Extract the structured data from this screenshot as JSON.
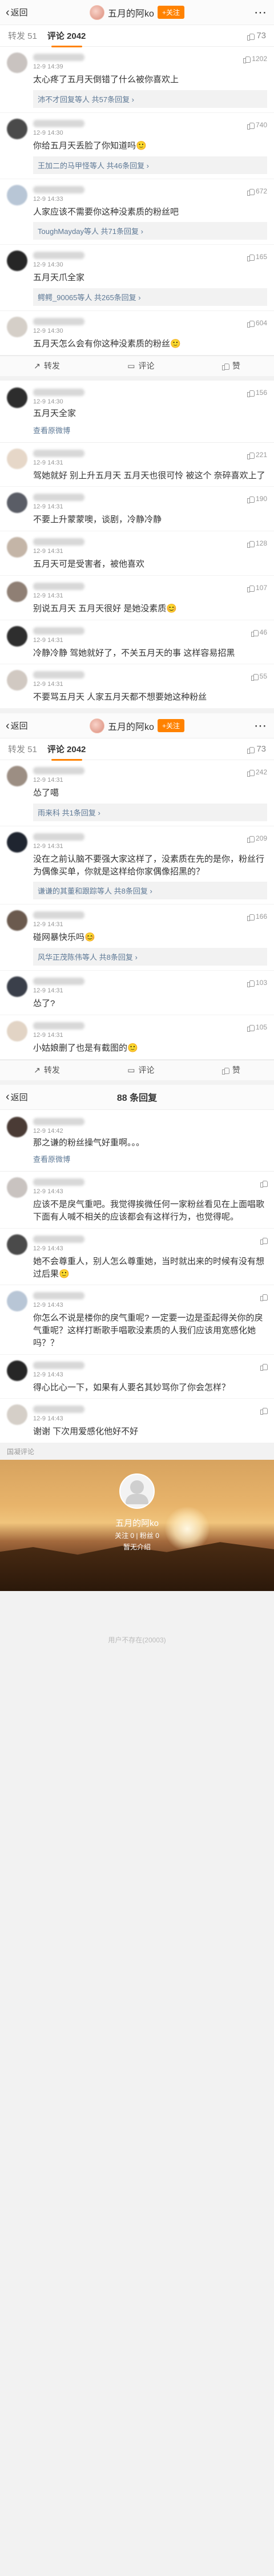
{
  "screen1": {
    "back_label": "返回",
    "title": "五月的阿ko",
    "follow_label": "+关注",
    "tabs": {
      "repost": "转发 51",
      "comment": "评论 2042",
      "likes": "73"
    },
    "comments": [
      {
        "time": "12-9 14:39",
        "text": "太心疼了五月天倒错了什么被你喜欢上",
        "replies": "沛不才回复等人 共57条回复 ›",
        "likes": "1202"
      },
      {
        "time": "12-9 14:30",
        "text": "你给五月天丢脸了你知道吗🙂",
        "replies": "王加二的马甲怪等人 共46条回复 ›",
        "likes": "740"
      },
      {
        "time": "12-9 14:33",
        "text": "人家应该不需要你这种没素质的粉丝吧",
        "replies": "ToughMayday等人 共71条回复 ›",
        "likes": "672"
      },
      {
        "time": "12-9 14:30",
        "text": "五月天爪全家",
        "replies": "鳄鳄_90065等人 共265条回复 ›",
        "likes": "165"
      },
      {
        "time": "12-9 14:30",
        "text": "五月天怎么会有你这种没素质的粉丝🙂",
        "replies": "",
        "likes": "604"
      }
    ],
    "bottom": {
      "repost": "转发",
      "comment": "评论",
      "like": "赞"
    }
  },
  "screen2": {
    "head_likes": "156",
    "head_time": "12-9 14:30",
    "head_text": "五月天全家",
    "view_original": "查看原微博",
    "comments": [
      {
        "time": "12-9 14:31",
        "text": "驾她就好 别上升五月天 五月天也很可怜 被这个 奈碎喜欢上了",
        "likes": "221"
      },
      {
        "time": "12-9 14:31",
        "text": "不要上升蒙蒙噢，谈剧，冷静冷静",
        "likes": "190"
      },
      {
        "time": "12-9 14:31",
        "text": "五月天可是受害者，被他喜欢",
        "likes": "128"
      },
      {
        "time": "12-9 14:31",
        "text": "别说五月天 五月天很好 是她没素质😊",
        "likes": "107"
      },
      {
        "time": "12-9 14:31",
        "text": "冷静冷静 驾她就好了，不关五月天的事 这样容易招黑",
        "likes": "46"
      },
      {
        "time": "12-9 14:31",
        "text": "不要骂五月天 人家五月天都不想要她这种粉丝",
        "likes": "55"
      }
    ]
  },
  "screen3": {
    "back_label": "返回",
    "title": "五月的阿ko",
    "follow_label": "+关注",
    "tabs": {
      "repost": "转发 51",
      "comment": "评论 2042",
      "likes": "73"
    },
    "comments": [
      {
        "time": "12-9 14:31",
        "text": "怂了噶",
        "replies": "雨来科 共1条回复 ›",
        "likes": "242"
      },
      {
        "time": "12-9 14:31",
        "text": "没在之前认脑不要强大家这样了，没素质在先的是你，粉丝行为偶像买单，你就是这样给你家偶像招黑的？",
        "replies": "谦谦的其董和跟踪等人 共8条回复 ›",
        "likes": "209"
      },
      {
        "time": "12-9 14:31",
        "text": "碰网暴快乐吗😊",
        "replies": "风华正茂陈伟等人 共8条回复 ›",
        "likes": "166"
      },
      {
        "time": "12-9 14:31",
        "text": "怂了?",
        "replies": "",
        "likes": "103"
      },
      {
        "time": "12-9 14:31",
        "text": "小姑娘删了也是有截图的🙂",
        "replies": "",
        "likes": "105"
      }
    ],
    "bottom": {
      "repost": "转发",
      "comment": "评论",
      "like": "赞"
    }
  },
  "screen4": {
    "back_label": "返回",
    "title": "88 条回复",
    "head_time": "12-9 14:42",
    "head_text": "那之谦的粉丝操气好重啊。。。",
    "view_original": "查看原微博",
    "comments": [
      {
        "time": "12-9 14:43",
        "text": "应该不是戾气重吧。我觉得挨微任何一家粉丝看见在上面唱歌下面有人喊不相关的应该都会有这样行为，也觉得呢。",
        "likes": ""
      },
      {
        "time": "12-9 14:43",
        "text": "她不会尊重人，别人怎么尊重她，当时就出来的时候有没有想过后果🙂",
        "likes": ""
      },
      {
        "time": "12-9 14:43",
        "text": "你怎么不说是楼你的戾气重呢? 一定要一边是歪起得关你的戾气重呢？这样打断歌手唱歌没素质的人我们应该用宽感化她吗？？",
        "likes": ""
      },
      {
        "time": "12-9 14:43",
        "text": "得心比心一下，如果有人要名其妙骂你了你会怎样？",
        "likes": ""
      },
      {
        "time": "12-9 14:43",
        "text": "谢谢 下次用爱感化他好不好",
        "likes": ""
      }
    ]
  },
  "screen5": {
    "section_label": "国凝评论",
    "name": "五月的阿ko",
    "stats": "关注 0  |  粉丝 0",
    "desc": "暂无介绍",
    "empty_text": "用户不存在(20003)"
  }
}
